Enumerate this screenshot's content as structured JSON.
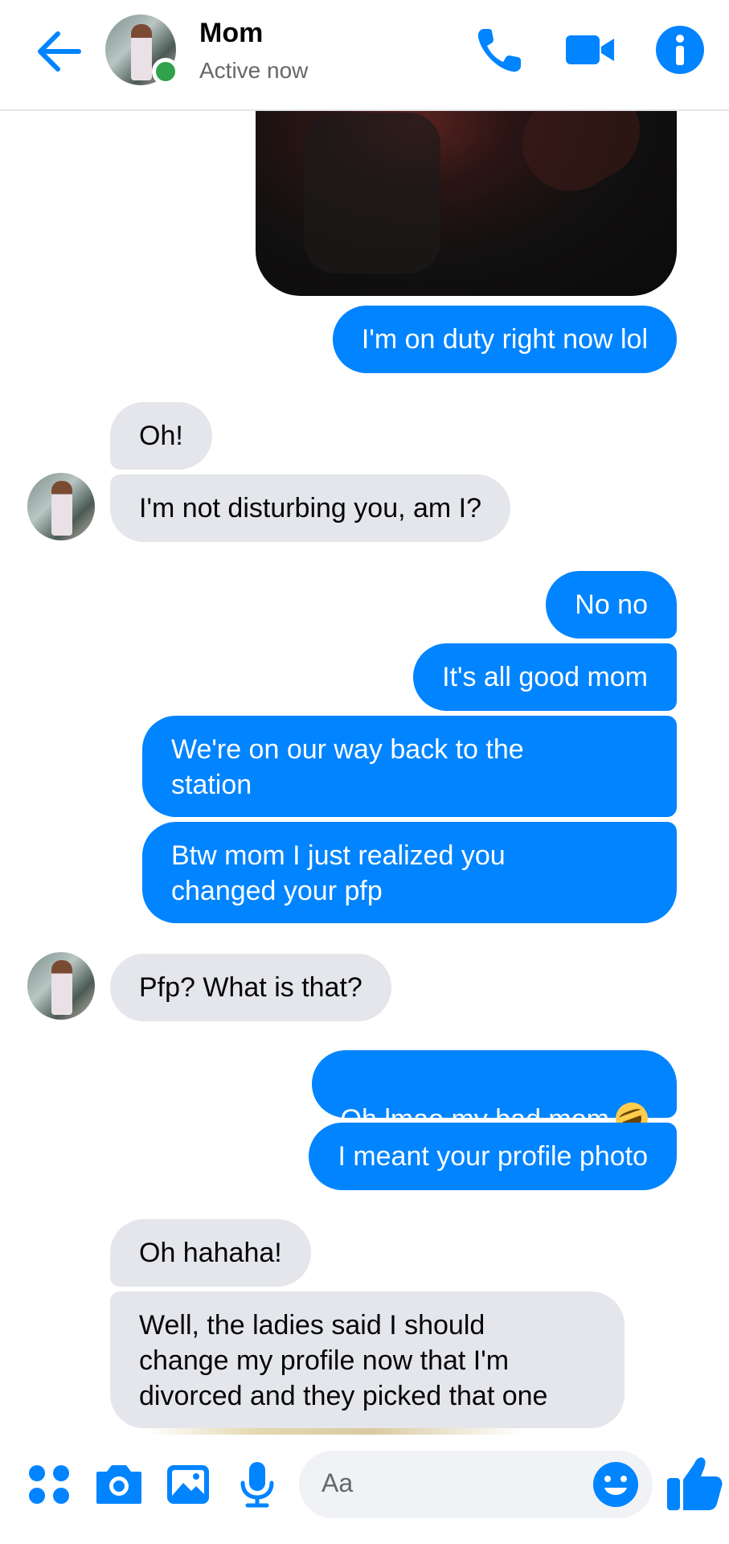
{
  "header": {
    "contact_name": "Mom",
    "status": "Active now"
  },
  "messages": [
    {
      "from": "me",
      "text": "I'm on duty right now lol"
    },
    {
      "from": "contact",
      "text": "Oh!"
    },
    {
      "from": "contact",
      "text": "I'm not disturbing you, am I?"
    },
    {
      "from": "me",
      "text": "No no"
    },
    {
      "from": "me",
      "text": "It's all good mom"
    },
    {
      "from": "me",
      "text": "We're on our way back to the\nstation"
    },
    {
      "from": "me",
      "text": "Btw mom I just realized you\nchanged your pfp"
    },
    {
      "from": "contact",
      "text": "Pfp? What is that?"
    },
    {
      "from": "me",
      "text": "Oh lmao my bad mom",
      "emoji": "rolling-on-floor-laughing-emoji"
    },
    {
      "from": "me",
      "text": "I meant your profile photo"
    },
    {
      "from": "contact",
      "text": "Oh hahaha!"
    },
    {
      "from": "contact",
      "text": "Well, the ladies said I should\nchange my profile now that I'm\ndivorced and they picked that one"
    }
  ],
  "composer": {
    "placeholder": "Aa"
  },
  "colors": {
    "accent": "#0084ff",
    "incoming_bubble": "#e4e6eb",
    "active_green": "#31a24c"
  },
  "icons": {
    "header": [
      "back-arrow-icon",
      "phone-icon",
      "video-camera-icon",
      "info-icon"
    ],
    "composer": [
      "more-apps-icon",
      "camera-icon",
      "image-icon",
      "microphone-icon",
      "emoji-icon",
      "thumbs-up-icon"
    ]
  }
}
